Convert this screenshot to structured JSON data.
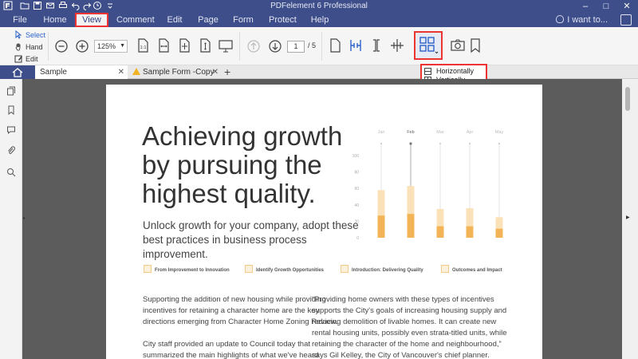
{
  "app": {
    "title": "PDFelement 6 Professional",
    "search_hint": "I want to..."
  },
  "menu": [
    {
      "label": "File"
    },
    {
      "label": "Home"
    },
    {
      "label": "View"
    },
    {
      "label": "Comment"
    },
    {
      "label": "Edit"
    },
    {
      "label": "Page"
    },
    {
      "label": "Form"
    },
    {
      "label": "Protect"
    },
    {
      "label": "Help"
    }
  ],
  "ribbon": {
    "modes": [
      {
        "label": "Select"
      },
      {
        "label": "Hand"
      },
      {
        "label": "Edit"
      }
    ],
    "zoom": "125%",
    "page_current": "1",
    "page_total": "/ 5"
  },
  "dropdown": {
    "items": [
      {
        "label": "Horizontally"
      },
      {
        "label": "Vertically"
      }
    ]
  },
  "tabs": [
    {
      "label": "Sample Documen...nded"
    },
    {
      "label": "Sample Form -Copy"
    }
  ],
  "document": {
    "headline": "Achieving growth by pursuing the highest quality.",
    "subline": "Unlock growth for your company, adopt these best practices in business process improvement.",
    "features": [
      {
        "label": "From Improvement to Innovation"
      },
      {
        "label": "Identify Growth Opportunities"
      },
      {
        "label": "Introduction: Delivering Quality"
      },
      {
        "label": "Outcomes and Impact"
      }
    ],
    "col1": "Supporting the addition of new housing while providing incentives for retaining a character home are the key directions emerging from Character Home Zoning Review.\n\nCity staff provided an update to Council today that summarized the main highlights of what we've heard through recent",
    "col2": "“Providing home owners with these types of incentives supports the City's goals of increasing housing supply and reducing demolition of livable homes.  It can create new rental housing units, possibly even strata-titled units, while retaining the character of the home and neighbourhood,” says Gil Kelley, the City of Vancouver's chief planner."
  },
  "chart_data": {
    "type": "bar",
    "categories": [
      "Jan",
      "Feb",
      "Mar",
      "Apr",
      "May"
    ],
    "ylim": [
      0,
      100
    ],
    "yticks": [
      "100",
      "80",
      "60",
      "40",
      "20",
      "0"
    ],
    "series": [
      {
        "values": [
          27,
          29,
          14,
          14,
          11
        ]
      },
      {
        "values": [
          31,
          34,
          21,
          22,
          14
        ]
      }
    ],
    "colors": {
      "dark": "#f2b457",
      "light": "#fbe1b8"
    }
  }
}
